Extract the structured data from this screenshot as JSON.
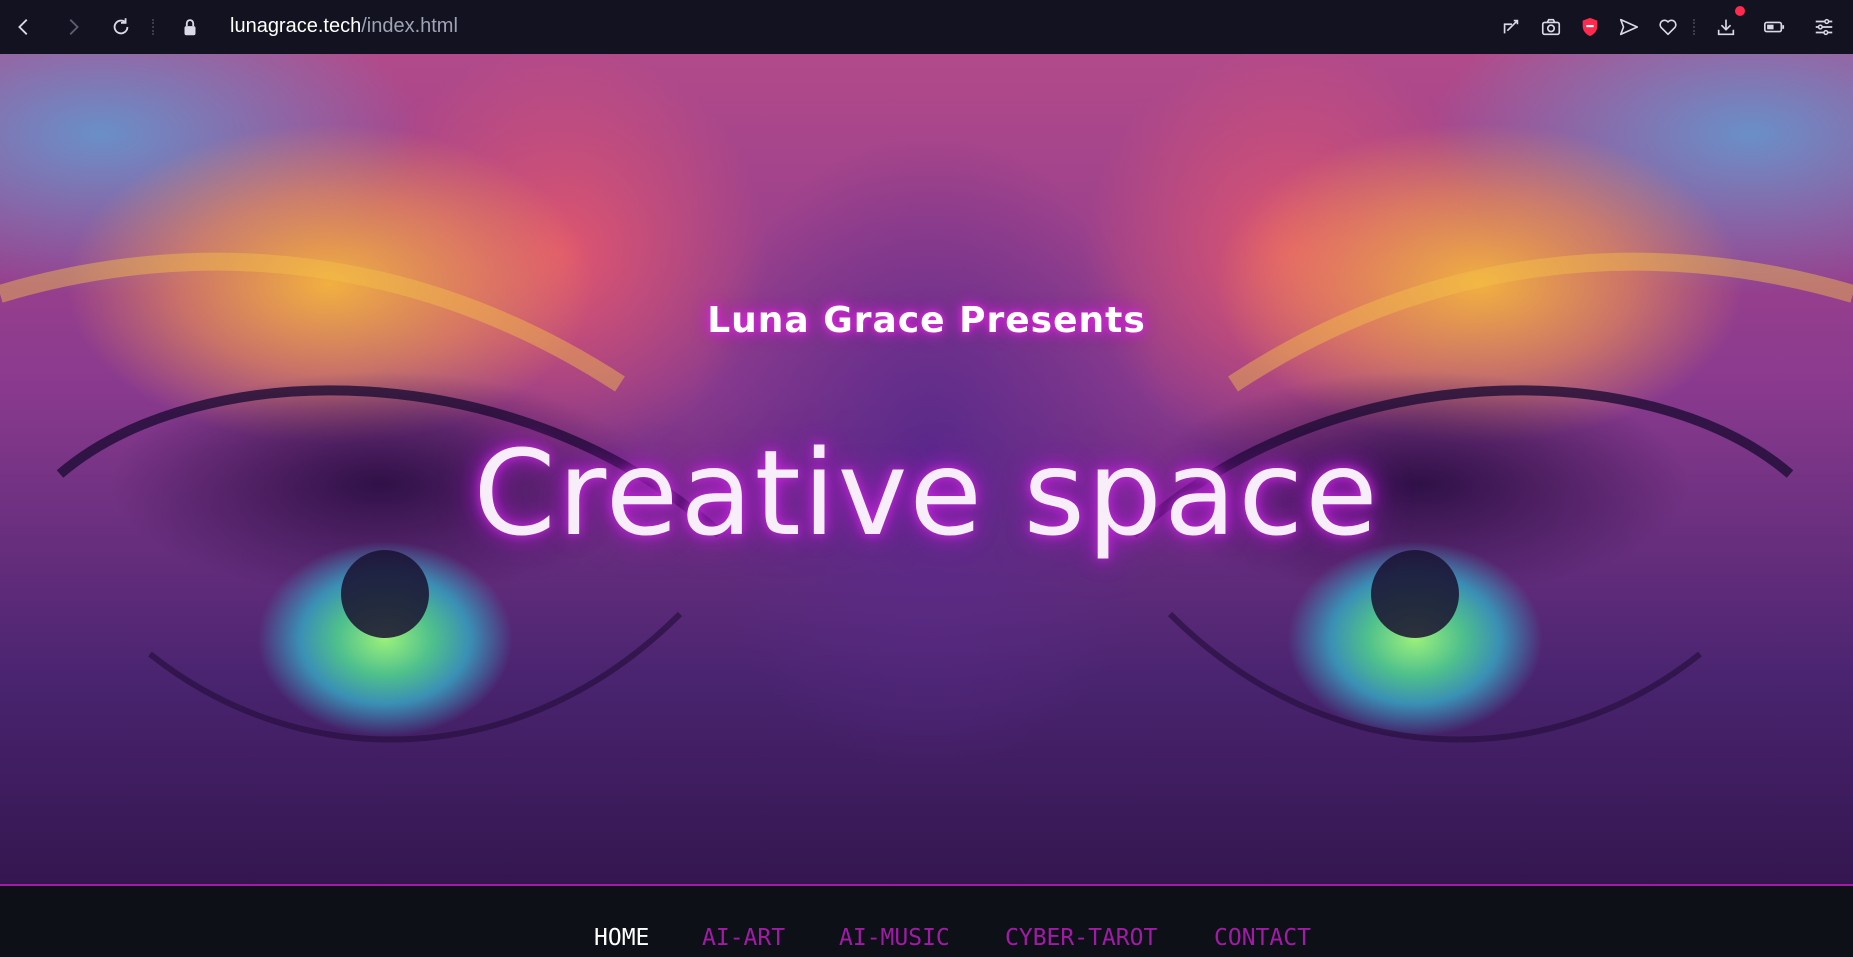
{
  "browser": {
    "url_host": "lunagrace.tech",
    "url_path": "/index.html",
    "icons": [
      "back-icon",
      "forward-icon",
      "reload-icon",
      "lock-icon",
      "easy-setup-icon",
      "snapshot-icon",
      "shield-icon",
      "send-icon",
      "heart-icon",
      "download-icon",
      "battery-icon",
      "settings-icon"
    ],
    "notification_color": "#ff2a4d"
  },
  "hero": {
    "subtitle": "Luna Grace Presents",
    "title": "Creative space",
    "glow_color": "#c22ad8"
  },
  "nav": {
    "items": [
      {
        "label": "HOME",
        "active": true
      },
      {
        "label": "AI-ART",
        "active": false
      },
      {
        "label": "AI-MUSIC",
        "active": false
      },
      {
        "label": "CYBER-TAROT",
        "active": false
      },
      {
        "label": "CONTACT",
        "active": false
      }
    ],
    "active_color": "#ffffff",
    "link_color": "#a31aa8"
  }
}
